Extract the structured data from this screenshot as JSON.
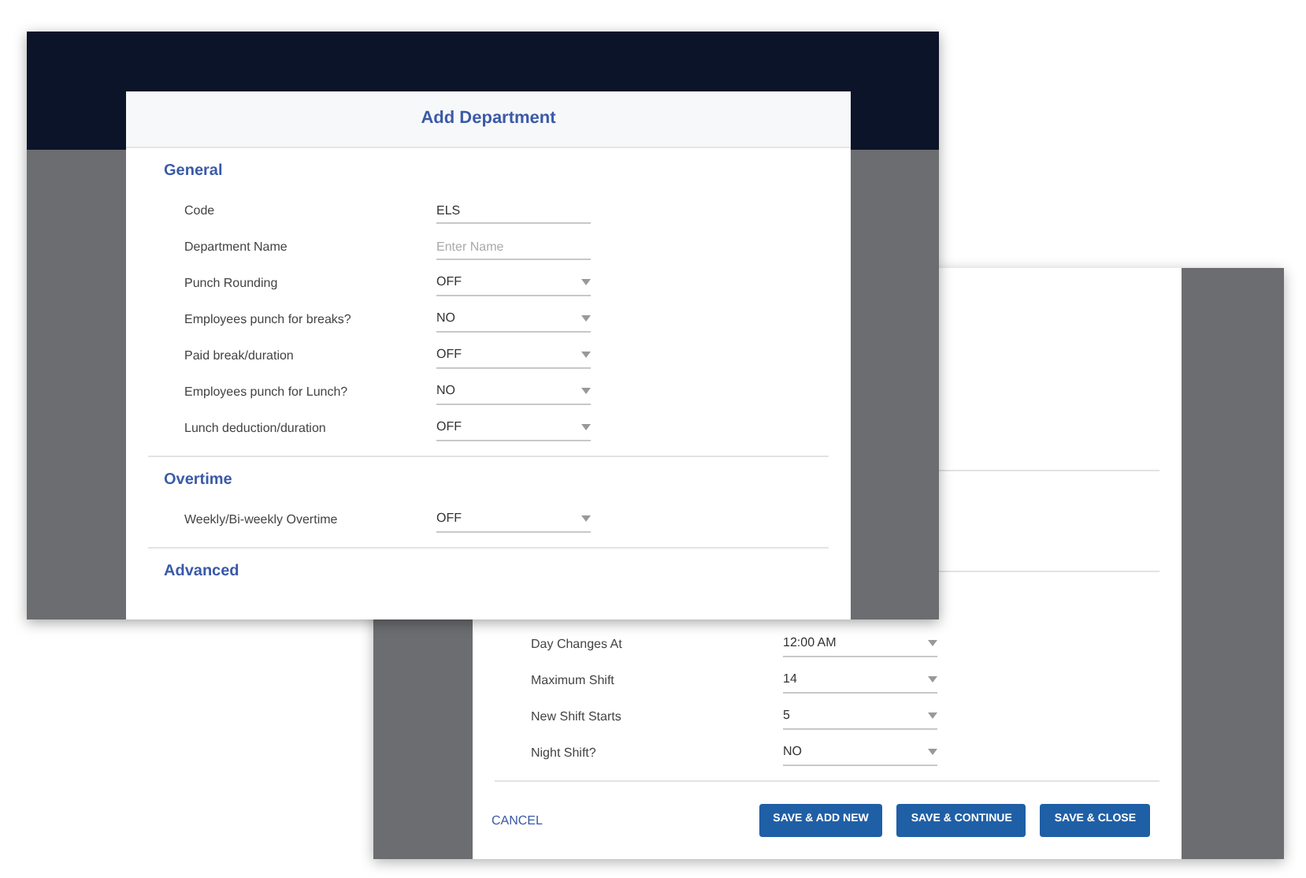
{
  "front_window": {
    "dialog": {
      "title": "Add Department",
      "sections": [
        {
          "title": "General",
          "fields": [
            {
              "label": "Code",
              "kind": "text",
              "value": "ELS"
            },
            {
              "label": "Department Name",
              "kind": "text",
              "placeholder": "Enter Name"
            },
            {
              "label": "Punch Rounding",
              "kind": "select",
              "value": "OFF"
            },
            {
              "label": "Employees punch for breaks?",
              "kind": "select",
              "value": "NO"
            },
            {
              "label": "Paid break/duration",
              "kind": "select",
              "value": "OFF"
            },
            {
              "label": "Employees punch for Lunch?",
              "kind": "select",
              "value": "NO"
            },
            {
              "label": "Lunch deduction/duration",
              "kind": "select",
              "value": "OFF"
            }
          ]
        },
        {
          "title": "Overtime",
          "fields": [
            {
              "label": "Weekly/Bi-weekly Overtime",
              "kind": "select",
              "value": "OFF"
            }
          ]
        },
        {
          "title": "Advanced"
        }
      ]
    }
  },
  "back_window": {
    "dialog": {
      "fields": [
        {
          "label": "Day Changes At",
          "kind": "select",
          "value": "12:00 AM"
        },
        {
          "label": "Maximum Shift",
          "kind": "select",
          "value": "14"
        },
        {
          "label": "New Shift Starts",
          "kind": "select",
          "value": "5"
        },
        {
          "label": "Night Shift?",
          "kind": "select",
          "value": "NO"
        }
      ],
      "cancel": "CANCEL",
      "buttons": [
        "SAVE & ADD NEW",
        "SAVE & CONTINUE",
        "SAVE & CLOSE"
      ]
    }
  }
}
